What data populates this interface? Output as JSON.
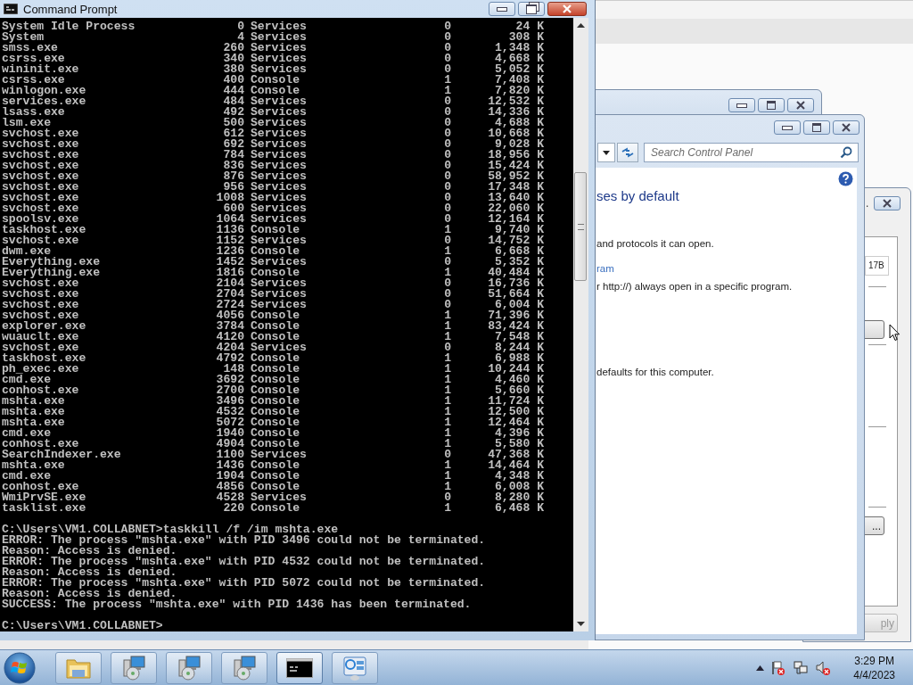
{
  "cmd_window": {
    "title": "Command Prompt",
    "process_rows": [
      {
        "column_1": "System Idle Process",
        "column_2": "0",
        "column_3": "Services",
        "column_4": "0",
        "column_5": "24 K"
      },
      {
        "column_1": "System",
        "column_2": "4",
        "column_3": "Services",
        "column_4": "0",
        "column_5": "308 K"
      },
      {
        "column_1": "smss.exe",
        "column_2": "260",
        "column_3": "Services",
        "column_4": "0",
        "column_5": "1,348 K"
      },
      {
        "column_1": "csrss.exe",
        "column_2": "340",
        "column_3": "Services",
        "column_4": "0",
        "column_5": "4,668 K"
      },
      {
        "column_1": "wininit.exe",
        "column_2": "380",
        "column_3": "Services",
        "column_4": "0",
        "column_5": "5,052 K"
      },
      {
        "column_1": "csrss.exe",
        "column_2": "400",
        "column_3": "Console",
        "column_4": "1",
        "column_5": "7,408 K"
      },
      {
        "column_1": "winlogon.exe",
        "column_2": "444",
        "column_3": "Console",
        "column_4": "1",
        "column_5": "7,820 K"
      },
      {
        "column_1": "services.exe",
        "column_2": "484",
        "column_3": "Services",
        "column_4": "0",
        "column_5": "12,532 K"
      },
      {
        "column_1": "lsass.exe",
        "column_2": "492",
        "column_3": "Services",
        "column_4": "0",
        "column_5": "14,336 K"
      },
      {
        "column_1": "lsm.exe",
        "column_2": "500",
        "column_3": "Services",
        "column_4": "0",
        "column_5": "4,688 K"
      },
      {
        "column_1": "svchost.exe",
        "column_2": "612",
        "column_3": "Services",
        "column_4": "0",
        "column_5": "10,668 K"
      },
      {
        "column_1": "svchost.exe",
        "column_2": "692",
        "column_3": "Services",
        "column_4": "0",
        "column_5": "9,028 K"
      },
      {
        "column_1": "svchost.exe",
        "column_2": "784",
        "column_3": "Services",
        "column_4": "0",
        "column_5": "18,956 K"
      },
      {
        "column_1": "svchost.exe",
        "column_2": "836",
        "column_3": "Services",
        "column_4": "0",
        "column_5": "15,424 K"
      },
      {
        "column_1": "svchost.exe",
        "column_2": "876",
        "column_3": "Services",
        "column_4": "0",
        "column_5": "58,952 K"
      },
      {
        "column_1": "svchost.exe",
        "column_2": "956",
        "column_3": "Services",
        "column_4": "0",
        "column_5": "17,348 K"
      },
      {
        "column_1": "svchost.exe",
        "column_2": "1008",
        "column_3": "Services",
        "column_4": "0",
        "column_5": "13,640 K"
      },
      {
        "column_1": "svchost.exe",
        "column_2": "600",
        "column_3": "Services",
        "column_4": "0",
        "column_5": "22,060 K"
      },
      {
        "column_1": "spoolsv.exe",
        "column_2": "1064",
        "column_3": "Services",
        "column_4": "0",
        "column_5": "12,164 K"
      },
      {
        "column_1": "taskhost.exe",
        "column_2": "1136",
        "column_3": "Console",
        "column_4": "1",
        "column_5": "9,740 K"
      },
      {
        "column_1": "svchost.exe",
        "column_2": "1152",
        "column_3": "Services",
        "column_4": "0",
        "column_5": "14,752 K"
      },
      {
        "column_1": "dwm.exe",
        "column_2": "1236",
        "column_3": "Console",
        "column_4": "1",
        "column_5": "6,668 K"
      },
      {
        "column_1": "Everything.exe",
        "column_2": "1452",
        "column_3": "Services",
        "column_4": "0",
        "column_5": "5,352 K"
      },
      {
        "column_1": "Everything.exe",
        "column_2": "1816",
        "column_3": "Console",
        "column_4": "1",
        "column_5": "40,484 K"
      },
      {
        "column_1": "svchost.exe",
        "column_2": "2104",
        "column_3": "Services",
        "column_4": "0",
        "column_5": "16,736 K"
      },
      {
        "column_1": "svchost.exe",
        "column_2": "2704",
        "column_3": "Services",
        "column_4": "0",
        "column_5": "51,664 K"
      },
      {
        "column_1": "svchost.exe",
        "column_2": "2724",
        "column_3": "Services",
        "column_4": "0",
        "column_5": "6,004 K"
      },
      {
        "column_1": "svchost.exe",
        "column_2": "4056",
        "column_3": "Console",
        "column_4": "1",
        "column_5": "71,396 K"
      },
      {
        "column_1": "explorer.exe",
        "column_2": "3784",
        "column_3": "Console",
        "column_4": "1",
        "column_5": "83,424 K"
      },
      {
        "column_1": "wuauclt.exe",
        "column_2": "4120",
        "column_3": "Console",
        "column_4": "1",
        "column_5": "7,548 K"
      },
      {
        "column_1": "svchost.exe",
        "column_2": "4204",
        "column_3": "Services",
        "column_4": "0",
        "column_5": "8,244 K"
      },
      {
        "column_1": "taskhost.exe",
        "column_2": "4792",
        "column_3": "Console",
        "column_4": "1",
        "column_5": "6,988 K"
      },
      {
        "column_1": "ph_exec.exe",
        "column_2": "148",
        "column_3": "Console",
        "column_4": "1",
        "column_5": "10,244 K"
      },
      {
        "column_1": "cmd.exe",
        "column_2": "3692",
        "column_3": "Console",
        "column_4": "1",
        "column_5": "4,460 K"
      },
      {
        "column_1": "conhost.exe",
        "column_2": "2700",
        "column_3": "Console",
        "column_4": "1",
        "column_5": "5,660 K"
      },
      {
        "column_1": "mshta.exe",
        "column_2": "3496",
        "column_3": "Console",
        "column_4": "1",
        "column_5": "11,724 K"
      },
      {
        "column_1": "mshta.exe",
        "column_2": "4532",
        "column_3": "Console",
        "column_4": "1",
        "column_5": "12,500 K"
      },
      {
        "column_1": "mshta.exe",
        "column_2": "5072",
        "column_3": "Console",
        "column_4": "1",
        "column_5": "12,464 K"
      },
      {
        "column_1": "cmd.exe",
        "column_2": "1940",
        "column_3": "Console",
        "column_4": "1",
        "column_5": "4,396 K"
      },
      {
        "column_1": "conhost.exe",
        "column_2": "4904",
        "column_3": "Console",
        "column_4": "1",
        "column_5": "5,580 K"
      },
      {
        "column_1": "SearchIndexer.exe",
        "column_2": "1100",
        "column_3": "Services",
        "column_4": "0",
        "column_5": "47,368 K"
      },
      {
        "column_1": "mshta.exe",
        "column_2": "1436",
        "column_3": "Console",
        "column_4": "1",
        "column_5": "14,464 K"
      },
      {
        "column_1": "cmd.exe",
        "column_2": "1904",
        "column_3": "Console",
        "column_4": "1",
        "column_5": "4,348 K"
      },
      {
        "column_1": "conhost.exe",
        "column_2": "4856",
        "column_3": "Console",
        "column_4": "1",
        "column_5": "6,008 K"
      },
      {
        "column_1": "WmiPrvSE.exe",
        "column_2": "4528",
        "column_3": "Services",
        "column_4": "0",
        "column_5": "8,280 K"
      },
      {
        "column_1": "tasklist.exe",
        "column_2": "220",
        "column_3": "Console",
        "column_4": "1",
        "column_5": "6,468 K"
      }
    ],
    "session": [
      {
        "kind": "command",
        "text": "C:\\Users\\VM1.COLLABNET>taskkill /f /im mshta.exe"
      },
      {
        "kind": "output",
        "text": "ERROR: The process \"mshta.exe\" with PID 3496 could not be terminated."
      },
      {
        "kind": "output",
        "text": "Reason: Access is denied."
      },
      {
        "kind": "output",
        "text": "ERROR: The process \"mshta.exe\" with PID 4532 could not be terminated."
      },
      {
        "kind": "output",
        "text": "Reason: Access is denied."
      },
      {
        "kind": "output",
        "text": "ERROR: The process \"mshta.exe\" with PID 5072 could not be terminated."
      },
      {
        "kind": "output",
        "text": "Reason: Access is denied."
      },
      {
        "kind": "output",
        "text": "SUCCESS: The process \"mshta.exe\" with PID 1436 has been terminated."
      },
      {
        "kind": "prompt",
        "text": "C:\\Users\\VM1.COLLABNET>"
      }
    ]
  },
  "control_panel": {
    "search": {
      "placeholder": "Search Control Panel"
    },
    "heading": "ses by default",
    "paragraphs": [
      {
        "kind": "text",
        "text": "and protocols it can open."
      },
      {
        "kind": "link",
        "text": "ram"
      },
      {
        "kind": "text",
        "text": "r http://) always open in a specific program."
      },
      {
        "kind": "text",
        "text": "defaults for this computer."
      }
    ]
  },
  "dialog": {
    "title": ".",
    "field_value": "17B",
    "buttons": [
      {
        "kind": "browse",
        "label": "..."
      },
      {
        "kind": "apply",
        "label": "ply"
      }
    ]
  },
  "taskbar": {
    "buttons": [
      {
        "kind": "folder"
      },
      {
        "kind": "installer"
      },
      {
        "kind": "installer"
      },
      {
        "kind": "installer"
      },
      {
        "kind": "console"
      },
      {
        "kind": "control-panel"
      }
    ],
    "clock": {
      "time": "3:29 PM",
      "date": "4/4/2023"
    }
  }
}
